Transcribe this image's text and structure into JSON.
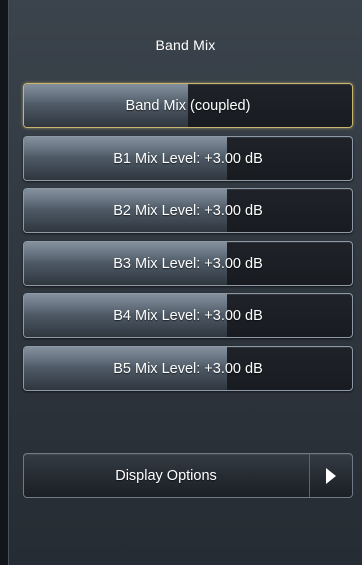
{
  "panel": {
    "title": "Band Mix"
  },
  "controls": [
    {
      "label": "Band Mix (coupled)",
      "level": 0.5,
      "selected": true
    },
    {
      "label": "B1 Mix Level: +3.00 dB",
      "level": 0.62,
      "selected": false
    },
    {
      "label": "B2 Mix Level: +3.00 dB",
      "level": 0.62,
      "selected": false
    },
    {
      "label": "B3 Mix Level: +3.00 dB",
      "level": 0.62,
      "selected": false
    },
    {
      "label": "B4 Mix Level: +3.00 dB",
      "level": 0.62,
      "selected": false
    },
    {
      "label": "B5 Mix Level: +3.00 dB",
      "level": 0.62,
      "selected": false
    }
  ],
  "display_options": {
    "label": "Display Options",
    "icon": "chevron-right-icon"
  },
  "colors": {
    "selected_border": "#c9b56e",
    "text": "#ffffff"
  }
}
